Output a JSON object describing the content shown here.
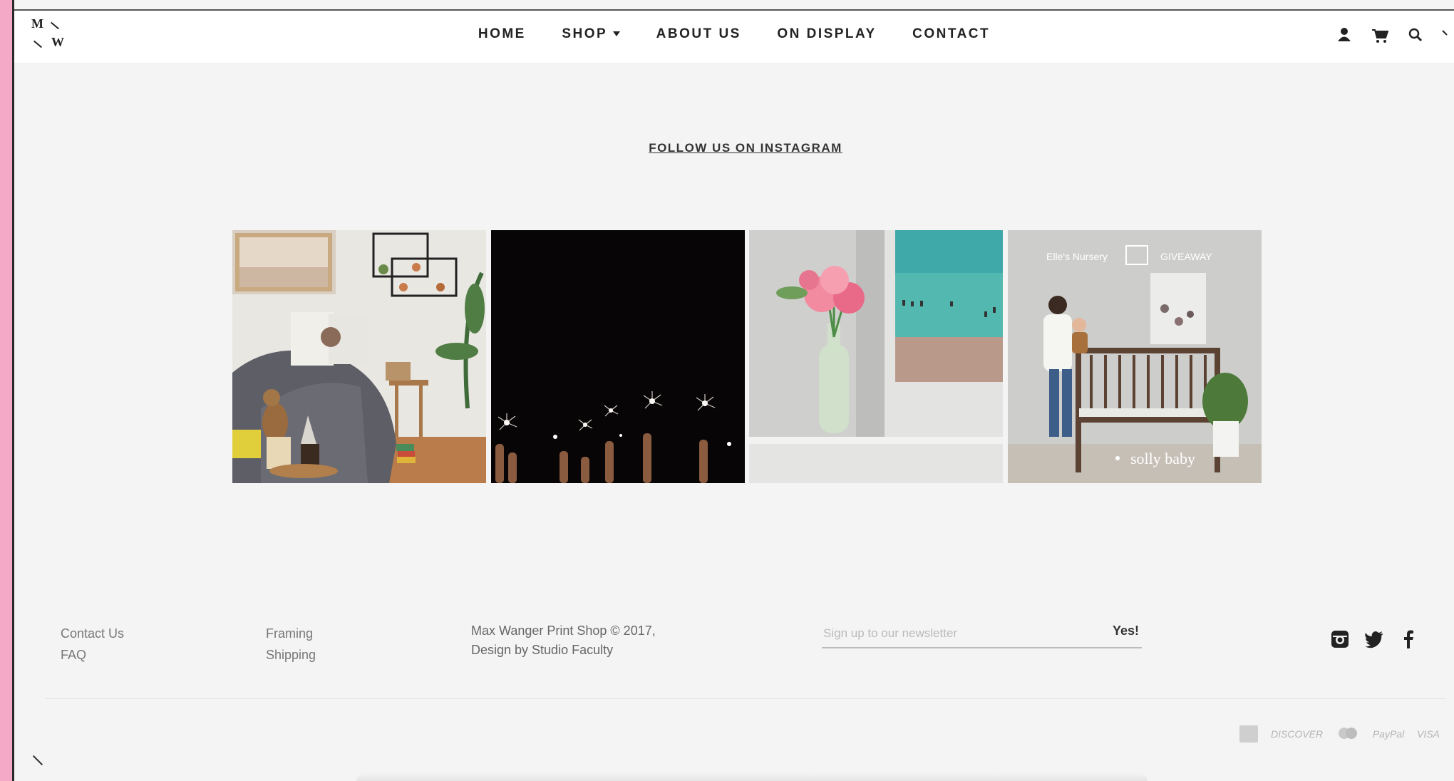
{
  "logo": {
    "line1": "M",
    "line2": "W"
  },
  "nav": {
    "home": "HOME",
    "shop": "SHOP",
    "about": "ABOUT US",
    "on_display": "ON DISPLAY",
    "contact": "CONTACT"
  },
  "header_icons": [
    "account-icon",
    "cart-icon",
    "search-icon"
  ],
  "instagram": {
    "follow_label": "FOLLOW US ON INSTAGRAM",
    "posts": [
      {
        "name": "reading-room-photo"
      },
      {
        "name": "sparklers-photo"
      },
      {
        "name": "peonies-beach-photo"
      },
      {
        "name": "nursery-giveaway-photo",
        "overlay_left": "Elle's Nursery",
        "overlay_right": "GIVEAWAY",
        "overlay_brand": "solly baby"
      }
    ]
  },
  "footer": {
    "col1": [
      "Contact Us",
      "FAQ"
    ],
    "col2": [
      "Framing",
      "Shipping"
    ],
    "copyright_line1": "Max Wanger Print Shop © 2017,",
    "copyright_line2": "Design by Studio Faculty",
    "newsletter_placeholder": "Sign up to our newsletter",
    "newsletter_button": "Yes!",
    "social": [
      "instagram-icon",
      "twitter-icon",
      "facebook-icon"
    ],
    "payments": [
      "DISCOVER",
      "PayPal",
      "VISA"
    ]
  },
  "colors": {
    "accent_pink": "#f4a9c6",
    "background": "#f4f4f4"
  }
}
